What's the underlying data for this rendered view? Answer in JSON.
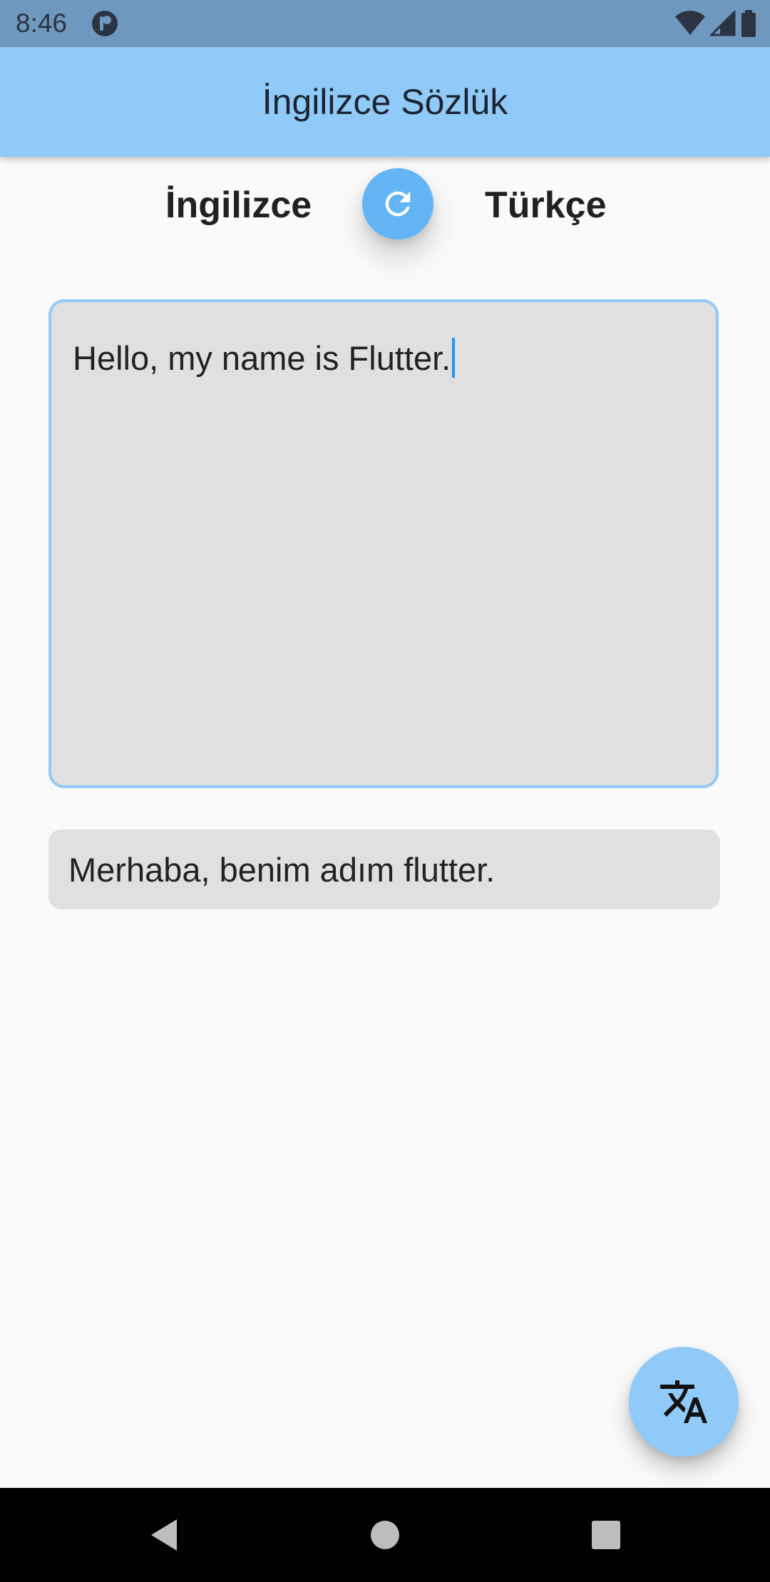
{
  "status_bar": {
    "time": "8:46",
    "icons": [
      "app-notification-icon",
      "wifi-icon",
      "cell-signal-icon",
      "battery-icon"
    ]
  },
  "app_bar": {
    "title": "İngilizce Sözlük"
  },
  "languages": {
    "source": "İngilizce",
    "target": "Türkçe",
    "swap_icon": "refresh-icon"
  },
  "input": {
    "value": "Hello, my name is Flutter."
  },
  "output": {
    "value": "Merhaba, benim adım flutter."
  },
  "fab": {
    "icon": "translate-icon"
  },
  "nav_bar": {
    "icons": [
      "back-icon",
      "home-icon",
      "recents-icon"
    ]
  },
  "colors": {
    "status_bar": "#6f98be",
    "app_bar": "#90caf9",
    "swap_button": "#64b5f6",
    "input_border": "#90caf9",
    "field_fill": "#e0e0e0",
    "caret": "#2196f3",
    "background": "#fafafa"
  }
}
